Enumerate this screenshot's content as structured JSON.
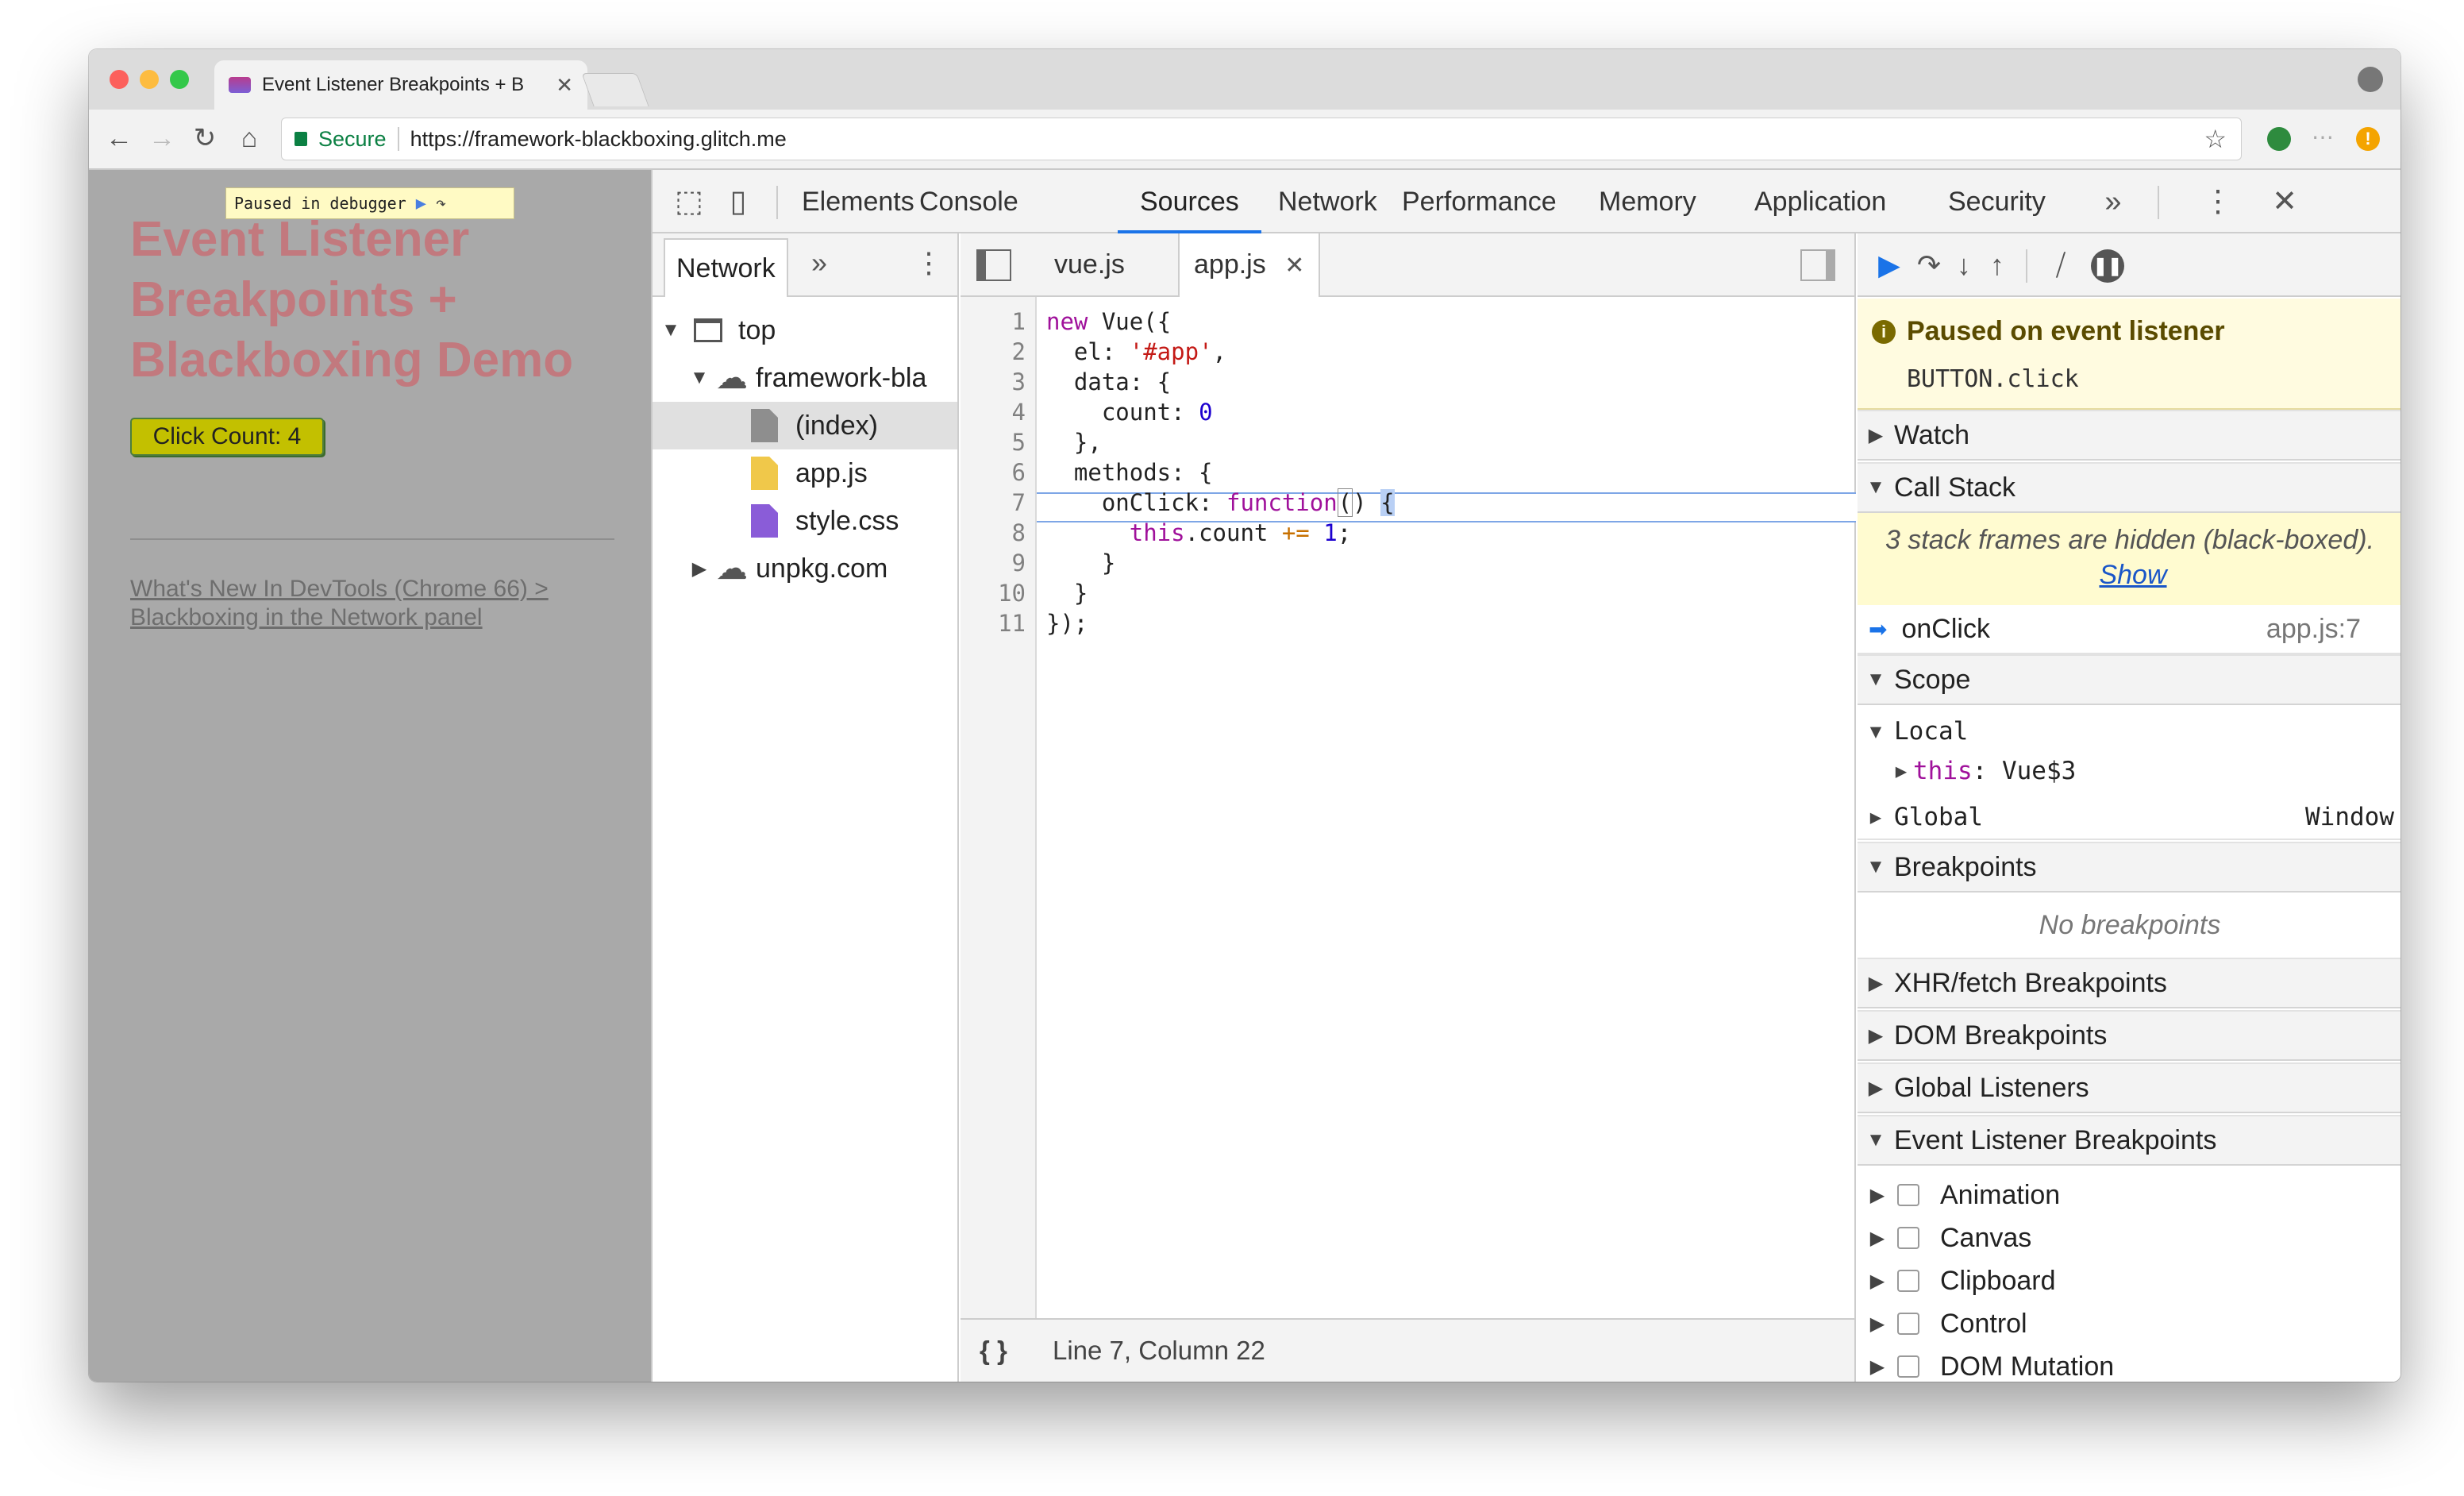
{
  "browser": {
    "tab_title": "Event Listener Breakpoints + B",
    "secure_label": "Secure",
    "url": "https://framework-blackboxing.glitch.me"
  },
  "page": {
    "paused_label": "Paused in debugger",
    "title": "Event Listener Breakpoints + Blackboxing Demo",
    "button_label": "Click Count: 4",
    "link_text": "What's New In DevTools (Chrome 66) > Blackboxing in the Network panel"
  },
  "devtools": {
    "tabs": [
      "Elements",
      "Console",
      "Sources",
      "Network",
      "Performance",
      "Memory",
      "Application",
      "Security"
    ],
    "active_tab": "Sources",
    "navigator": {
      "tab": "Network",
      "tree": [
        "top",
        "framework-bla",
        "(index)",
        "app.js",
        "style.css",
        "unpkg.com"
      ]
    },
    "editor": {
      "tabs": [
        "vue.js",
        "app.js"
      ],
      "active_tab": "app.js",
      "line_numbers": [
        "1",
        "2",
        "3",
        "4",
        "5",
        "6",
        "7",
        "8",
        "9",
        "10",
        "11"
      ],
      "status": "Line 7, Column 22",
      "format_icon": "{ }"
    },
    "sidebar": {
      "paused_title": "Paused on event listener",
      "paused_detail": "BUTTON.click",
      "watch": "Watch",
      "call_stack": "Call Stack",
      "hidden_frames_text": "3 stack frames are hidden (black-boxed).",
      "show_link": "Show",
      "frame_name": "onClick",
      "frame_location": "app.js:7",
      "scope": "Scope",
      "local": "Local",
      "this_key": "this",
      "this_value": "Vue$3",
      "global": "Global",
      "global_value": "Window",
      "breakpoints": "Breakpoints",
      "no_breakpoints": "No breakpoints",
      "xhr": "XHR/fetch Breakpoints",
      "dom": "DOM Breakpoints",
      "global_listeners": "Global Listeners",
      "event_listener_bps": "Event Listener Breakpoints",
      "event_categories": [
        "Animation",
        "Canvas",
        "Clipboard",
        "Control",
        "DOM Mutation"
      ]
    }
  },
  "colors": {
    "accent": "#1a73e8",
    "page_bg": "#a9a9a9",
    "page_title": "#c2797e",
    "button_bg": "#c3c000"
  }
}
